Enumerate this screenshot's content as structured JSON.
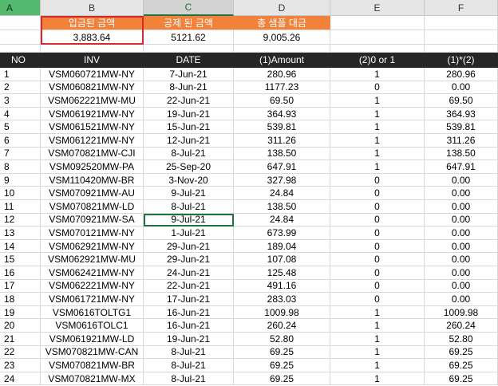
{
  "columns": [
    "A",
    "B",
    "C",
    "D",
    "E",
    "F"
  ],
  "summary": {
    "labels": [
      "입금된 금액",
      "공제 된 금액",
      "총 샘플 대금"
    ],
    "values": [
      "3,883.64",
      "5121.62",
      "9,005.26"
    ]
  },
  "table": {
    "headers": [
      "NO",
      "INV",
      "DATE",
      "(1)Amount",
      "(2)0 or 1",
      "(1)*(2)"
    ],
    "rows": [
      [
        "1",
        "VSM060721MW-NY",
        "7-Jun-21",
        "280.96",
        "1",
        "280.96"
      ],
      [
        "2",
        "VSM060821MW-NY",
        "8-Jun-21",
        "1177.23",
        "0",
        "0.00"
      ],
      [
        "3",
        "VSM062221MW-MU",
        "22-Jun-21",
        "69.50",
        "1",
        "69.50"
      ],
      [
        "4",
        "VSM061921MW-NY",
        "19-Jun-21",
        "364.93",
        "1",
        "364.93"
      ],
      [
        "5",
        "VSM061521MW-NY",
        "15-Jun-21",
        "539.81",
        "1",
        "539.81"
      ],
      [
        "6",
        "VSM061221MW-NY",
        "12-Jun-21",
        "311.26",
        "1",
        "311.26"
      ],
      [
        "7",
        "VSM070821MW-CJI",
        "8-Jul-21",
        "138.50",
        "1",
        "138.50"
      ],
      [
        "8",
        "VSM092520MW-PA",
        "25-Sep-20",
        "647.91",
        "1",
        "647.91"
      ],
      [
        "9",
        "VSM110420MW-BR",
        "3-Nov-20",
        "327.98",
        "0",
        "0.00"
      ],
      [
        "10",
        "VSM070921MW-AU",
        "9-Jul-21",
        "24.84",
        "0",
        "0.00"
      ],
      [
        "11",
        "VSM070821MW-LD",
        "8-Jul-21",
        "138.50",
        "0",
        "0.00"
      ],
      [
        "12",
        "VSM070921MW-SA",
        "9-Jul-21",
        "24.84",
        "0",
        "0.00"
      ],
      [
        "13",
        "VSM070121MW-NY",
        "1-Jul-21",
        "673.99",
        "0",
        "0.00"
      ],
      [
        "14",
        "VSM062921MW-NY",
        "29-Jun-21",
        "189.04",
        "0",
        "0.00"
      ],
      [
        "15",
        "VSM062921MW-MU",
        "29-Jun-21",
        "107.08",
        "0",
        "0.00"
      ],
      [
        "16",
        "VSM062421MW-NY",
        "24-Jun-21",
        "125.48",
        "0",
        "0.00"
      ],
      [
        "17",
        "VSM062221MW-NY",
        "22-Jun-21",
        "491.16",
        "0",
        "0.00"
      ],
      [
        "18",
        "VSM061721MW-NY",
        "17-Jun-21",
        "283.03",
        "0",
        "0.00"
      ],
      [
        "19",
        "VSM0616TOLTG1",
        "16-Jun-21",
        "1009.98",
        "1",
        "1009.98"
      ],
      [
        "20",
        "VSM0616TOLC1",
        "16-Jun-21",
        "260.24",
        "1",
        "260.24"
      ],
      [
        "21",
        "VSM061921MW-LD",
        "19-Jun-21",
        "52.80",
        "1",
        "52.80"
      ],
      [
        "22",
        "VSM070821MW-CAN",
        "8-Jul-21",
        "69.25",
        "1",
        "69.25"
      ],
      [
        "23",
        "VSM070821MW-BR",
        "8-Jul-21",
        "69.25",
        "1",
        "69.25"
      ],
      [
        "24",
        "VSM070821MW-MX",
        "8-Jul-21",
        "69.25",
        "1",
        "69.25"
      ]
    ]
  }
}
